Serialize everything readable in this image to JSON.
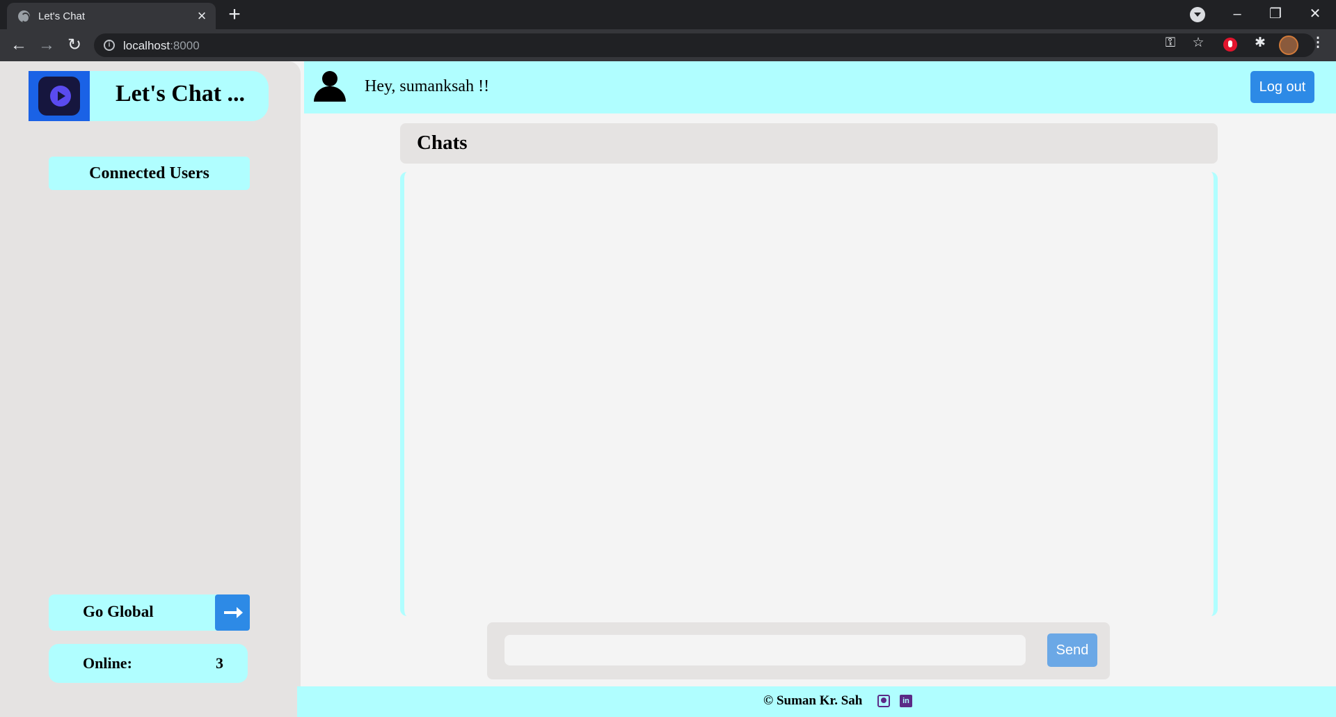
{
  "browser": {
    "tab_title": "Let's Chat",
    "url_host": "localhost",
    "url_port": ":8000"
  },
  "sidebar": {
    "logo_text": "Let's Chat ...",
    "connected_users_label": "Connected Users",
    "go_global_label": "Go Global",
    "online_label": "Online:",
    "online_count": "3"
  },
  "header": {
    "greeting": "Hey, sumanksah !!",
    "logout_label": "Log out"
  },
  "chat": {
    "title": "Chats",
    "input_value": "",
    "send_label": "Send"
  },
  "footer": {
    "copyright": "© Suman Kr. Sah"
  },
  "colors": {
    "accent_cyan": "#b0feff",
    "button_blue": "#2d8ae6",
    "sidebar_bg": "#e5e3e2",
    "page_bg": "#f4f4f4"
  }
}
